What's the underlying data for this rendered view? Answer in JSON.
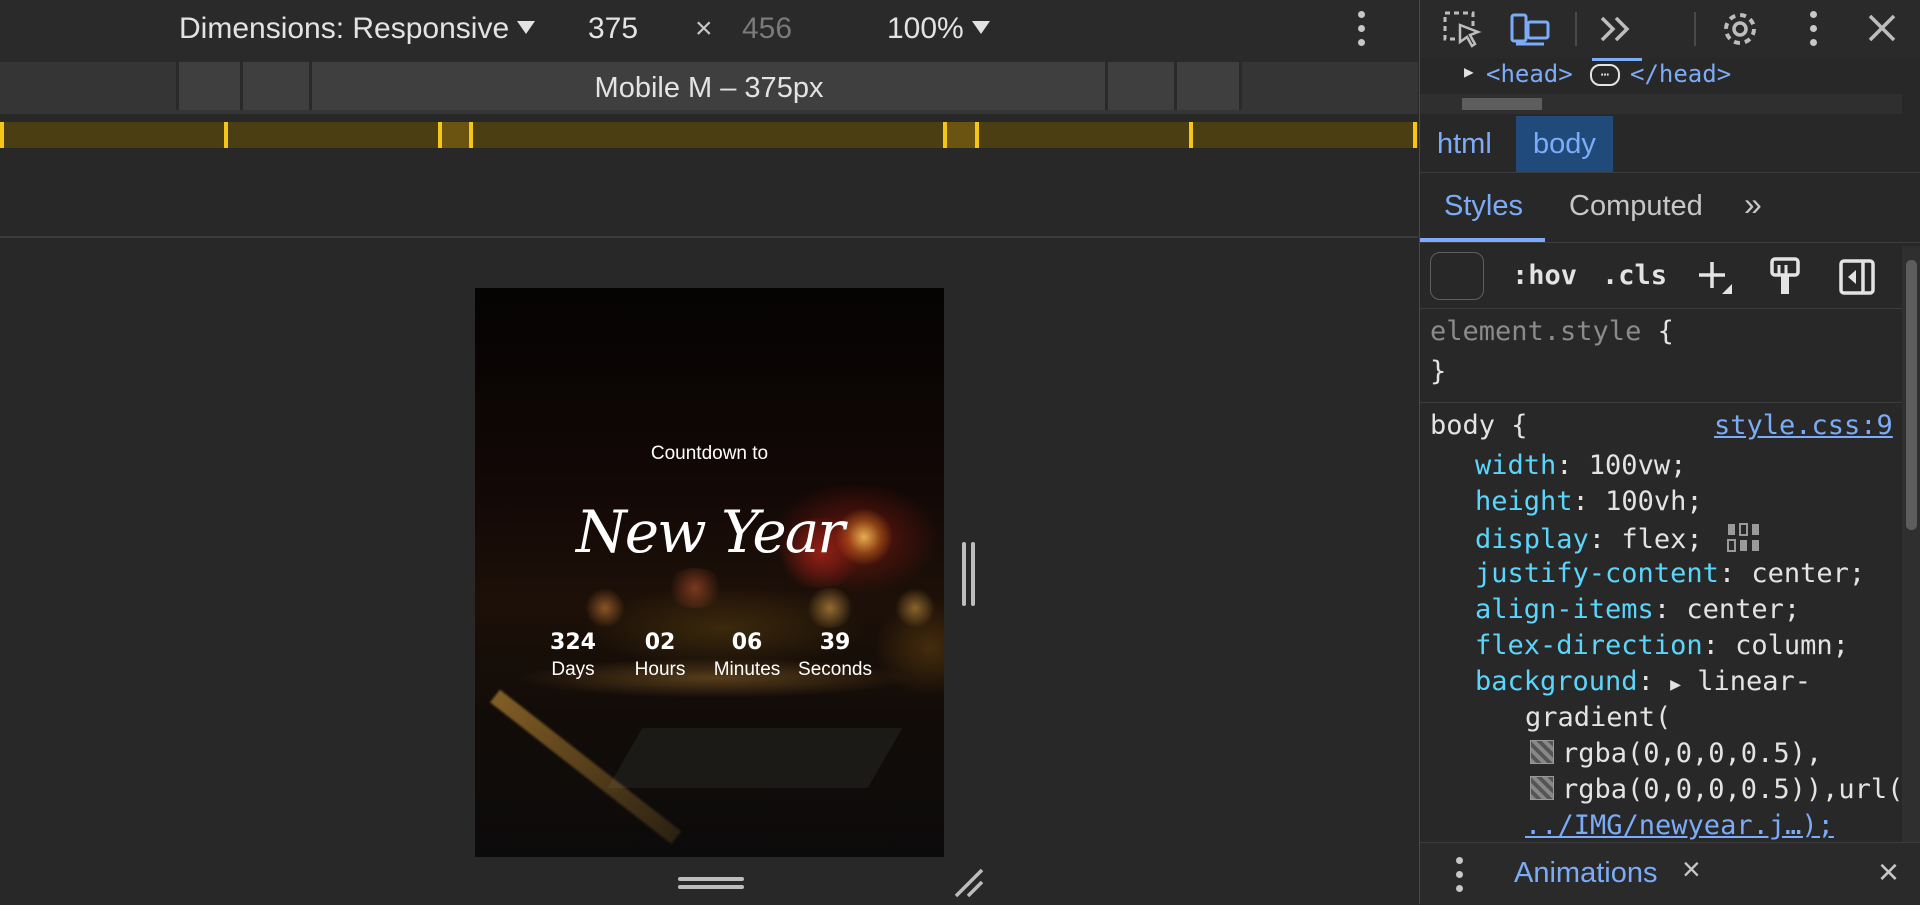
{
  "toolbar": {
    "dimensions_label": "Dimensions: Responsive",
    "width_value": "375",
    "times": "×",
    "height_value": "456",
    "zoom_label": "100%"
  },
  "presets": {
    "active_label": "Mobile M – 375px"
  },
  "viewport": {
    "title": "Countdown to",
    "script_title": "New Year",
    "countdown": [
      {
        "value": "324",
        "label": "Days"
      },
      {
        "value": "02",
        "label": "Hours"
      },
      {
        "value": "06",
        "label": "Minutes"
      },
      {
        "value": "39",
        "label": "Seconds"
      }
    ]
  },
  "devtools": {
    "elements_line": {
      "open": "<head>",
      "ellipsis": "⋯",
      "close": "</head>"
    },
    "breadcrumbs": [
      "html",
      "body"
    ],
    "subtabs": {
      "styles": "Styles",
      "computed": "Computed",
      "more": "»"
    },
    "filter": {
      "hov": ":hov",
      "cls": ".cls"
    },
    "styles": {
      "element_style_selector": "element.style",
      "open_brace": "{",
      "close_brace": "}",
      "body_selector": "body",
      "source": "style.css:9",
      "declarations": [
        {
          "prop": "width",
          "value": "100vw;"
        },
        {
          "prop": "height",
          "value": "100vh;"
        },
        {
          "prop": "display",
          "value": "flex;"
        },
        {
          "prop": "justify-content",
          "value": "center;"
        },
        {
          "prop": "align-items",
          "value": "center;"
        },
        {
          "prop": "flex-direction",
          "value": "column;"
        },
        {
          "prop": "background",
          "value": "linear-"
        }
      ],
      "bg_cont1": "gradient(",
      "bg_cont2": "rgba(0,0,0,0.5),",
      "bg_cont3": "rgba(0,0,0,0.5)),url(",
      "bg_cont4": "../IMG/newyear.j…);"
    },
    "drawer": {
      "tab": "Animations",
      "close_tab": "×",
      "close": "×"
    }
  },
  "colors": {
    "accent": "#7cacf8",
    "property": "#5cd5fb",
    "media_query": "#f5c518"
  }
}
